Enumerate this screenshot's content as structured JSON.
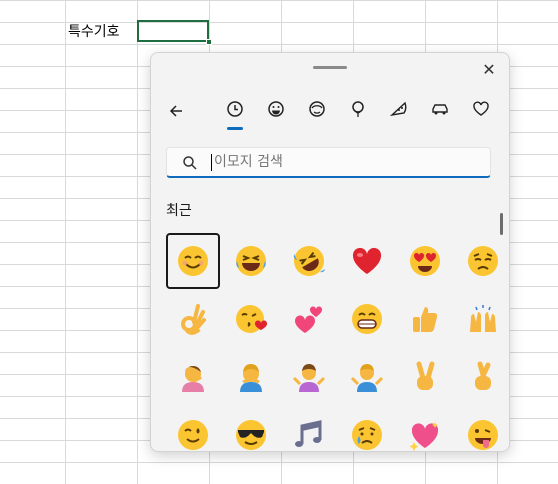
{
  "sheet": {
    "cell_text": "특수기호"
  },
  "panel": {
    "close_label": "✕",
    "search_placeholder": "이모지 검색",
    "section_title": "최근",
    "tabs": [
      "recent-icon",
      "emoji-face-icon",
      "people-icon",
      "celebration-icon",
      "food-icon",
      "travel-icon",
      "symbols-icon"
    ],
    "emojis": [
      [
        "smiling-face",
        "grinning-squinting-face",
        "rolling-laughing-face",
        "red-heart",
        "heart-eyes-face",
        "pleading-face"
      ],
      [
        "ok-hand",
        "face-blowing-kiss",
        "two-hearts",
        "beaming-face",
        "thumbs-up",
        "raising-hands"
      ],
      [
        "person-facepalming",
        "person-gesturing-ok",
        "person-shrugging",
        "man-shrugging",
        "victory-hand",
        "crossed-fingers"
      ],
      [
        "winking-face",
        "sunglasses-face",
        "musical-notes",
        "crying-face",
        "sparkling-heart",
        "face-with-tongue"
      ]
    ],
    "accent": "#0f6cbd"
  }
}
